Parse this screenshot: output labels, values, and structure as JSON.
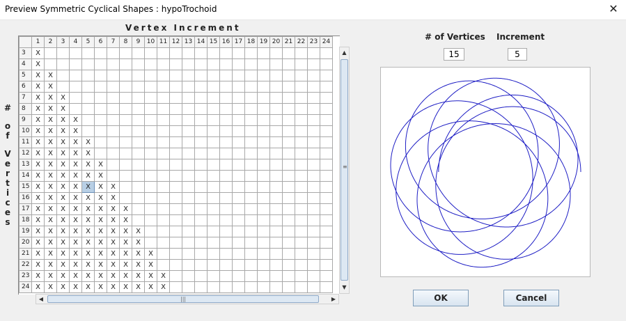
{
  "window": {
    "title": "Preview Symmetric Cyclical Shapes : hypoTrochoid",
    "close_glyph": "✕"
  },
  "grid": {
    "column_header_title": "Vertex Increment",
    "row_header_title_lines": [
      "#",
      "o",
      "f",
      "V",
      "e",
      "r",
      "t",
      "i",
      "c",
      "e",
      "s"
    ],
    "columns": [
      "1",
      "2",
      "3",
      "4",
      "5",
      "6",
      "7",
      "8",
      "9",
      "10",
      "11",
      "12",
      "13",
      "14",
      "15",
      "16",
      "17",
      "18",
      "19",
      "20",
      "21",
      "22",
      "23",
      "24"
    ],
    "rows": [
      {
        "label": "3",
        "marks": 1
      },
      {
        "label": "4",
        "marks": 1
      },
      {
        "label": "5",
        "marks": 2
      },
      {
        "label": "6",
        "marks": 2
      },
      {
        "label": "7",
        "marks": 3
      },
      {
        "label": "8",
        "marks": 3
      },
      {
        "label": "9",
        "marks": 4
      },
      {
        "label": "10",
        "marks": 4
      },
      {
        "label": "11",
        "marks": 5
      },
      {
        "label": "12",
        "marks": 5
      },
      {
        "label": "13",
        "marks": 6
      },
      {
        "label": "14",
        "marks": 6
      },
      {
        "label": "15",
        "marks": 7
      },
      {
        "label": "16",
        "marks": 7
      },
      {
        "label": "17",
        "marks": 8
      },
      {
        "label": "18",
        "marks": 8
      },
      {
        "label": "19",
        "marks": 9
      },
      {
        "label": "20",
        "marks": 9
      },
      {
        "label": "21",
        "marks": 10
      },
      {
        "label": "22",
        "marks": 10
      },
      {
        "label": "23",
        "marks": 11
      },
      {
        "label": "24",
        "marks": 11
      }
    ],
    "mark_glyph": "X",
    "selected": {
      "row": "15",
      "column": "5"
    }
  },
  "settings": {
    "vertices_label": "# of Vertices",
    "vertices_value": "15",
    "increment_label": "Increment",
    "increment_value": "5"
  },
  "preview": {
    "stroke_color": "#1c1cc4",
    "vertices": 15,
    "increment": 5
  },
  "buttons": {
    "ok_label": "OK",
    "cancel_label": "Cancel"
  },
  "icons": {
    "scroll_up": "▲",
    "scroll_down": "▼",
    "scroll_left": "◀",
    "scroll_right": "▶",
    "vgrip": "≡",
    "hgrip": "|||"
  }
}
